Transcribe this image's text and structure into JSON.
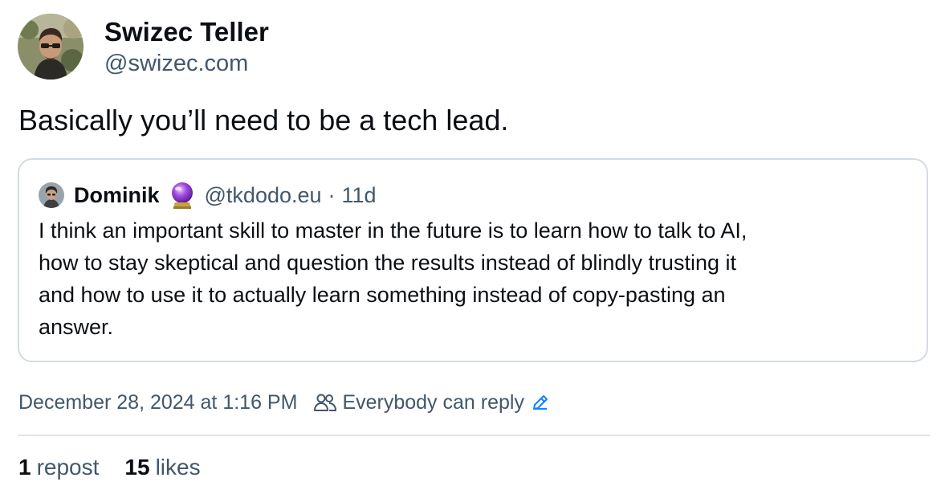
{
  "author": {
    "display_name": "Swizec Teller",
    "handle": "@swizec.com",
    "avatar_icon": "user-avatar-photo"
  },
  "post": {
    "text": "Basically you’ll need to be a tech lead."
  },
  "quoted_post": {
    "author_name": "Dominik",
    "author_emoji_icon": "crystal-ball-icon",
    "author_handle": "@tkdodo.eu",
    "separator": "·",
    "age": "11d",
    "text_lines": [
      "I think an important skill to master in the future is to learn how to talk to AI,",
      "how to stay skeptical and question the results instead of blindly trusting it",
      "and how to use it to actually learn something instead of copy-pasting an",
      "answer."
    ]
  },
  "meta": {
    "timestamp": "December 28, 2024 at 1:16 PM",
    "reply_setting": "Everybody can reply",
    "reply_icon": "people-icon",
    "edit_icon": "pencil-icon"
  },
  "stats": {
    "reposts_count": "1",
    "reposts_label": "repost",
    "likes_count": "15",
    "likes_label": "likes"
  },
  "colors": {
    "text_primary": "#0b0f14",
    "text_secondary": "#42576c",
    "border": "#d4dbe2",
    "accent_blue": "#1083fe"
  }
}
